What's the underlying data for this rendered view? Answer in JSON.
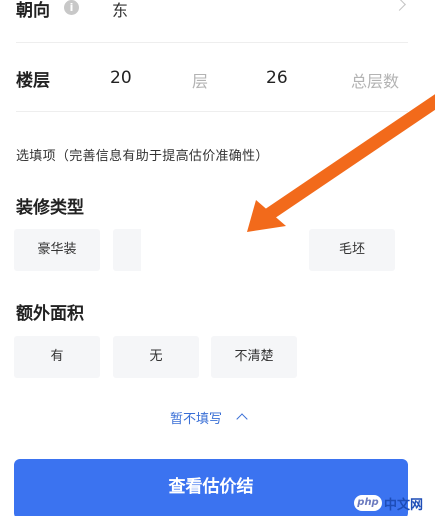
{
  "orientation": {
    "label": "朝向",
    "value": "东",
    "info_glyph": "i"
  },
  "floor": {
    "label": "楼层",
    "current": "20",
    "current_unit": "层",
    "total": "26",
    "total_unit": "总层数"
  },
  "optional_hint": "选填项（完善信息有助于提高估价准确性）",
  "decoration": {
    "title": "装修类型",
    "options": [
      {
        "label": "豪华装"
      },
      {
        "label": ""
      },
      {
        "label": "毛坯"
      }
    ]
  },
  "extra_area": {
    "title": "额外面积",
    "options": [
      {
        "label": "有"
      },
      {
        "label": "无"
      },
      {
        "label": "不清楚"
      }
    ]
  },
  "collapse_link": "暂不填写",
  "submit_label": "查看估价结",
  "watermark": {
    "badge": "php",
    "text": "中文网"
  },
  "colors": {
    "accent": "#3b73f0",
    "link": "#3a6fd6",
    "arrow": "#f26a1b",
    "option_bg": "#f5f6f8"
  }
}
